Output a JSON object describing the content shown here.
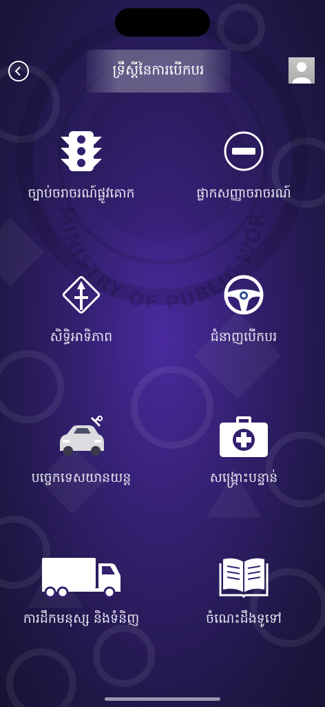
{
  "header": {
    "title": "ទ្រឹស្តីនៃការបើកបរ",
    "back_icon": "chevron-left-icon",
    "avatar_icon": "user-avatar-icon"
  },
  "background": {
    "emblem_text": "MINISTRY OF PUBLIC WORKS AND TRANSPORT",
    "gradient_center": "#4a2a9e",
    "gradient_edge": "#171334"
  },
  "menu": [
    {
      "label": "ច្បាប់ចរាចរណ៍ផ្លូវគោក",
      "icon": "traffic-light-icon"
    },
    {
      "label": "ផ្លាកសញ្ញាចរាចរណ៍",
      "icon": "no-entry-sign-icon"
    },
    {
      "label": "សិទ្ធិអាទិភាព",
      "icon": "priority-road-icon"
    },
    {
      "label": "ជំនាញបើកបរ",
      "icon": "steering-wheel-icon"
    },
    {
      "label": "បច្ចេកទេសយានយន្ត",
      "icon": "car-repair-icon"
    },
    {
      "label": "សង្គ្រោះបន្ទាន់",
      "icon": "first-aid-kit-icon"
    },
    {
      "label": "ការដឹកមនុស្ស និងទំនិញ",
      "icon": "truck-icon"
    },
    {
      "label": "ចំណេះដឹងទូទៅ",
      "icon": "open-book-icon"
    }
  ]
}
